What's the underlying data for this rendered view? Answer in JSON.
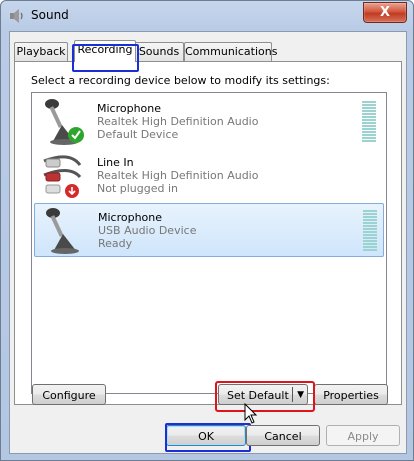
{
  "window": {
    "title": "Sound",
    "close_label": "X"
  },
  "tabs": [
    {
      "label": "Playback",
      "active": false
    },
    {
      "label": "Recording",
      "active": true
    },
    {
      "label": "Sounds",
      "active": false
    },
    {
      "label": "Communications",
      "active": false
    }
  ],
  "instruction": "Select a recording device below to modify its settings:",
  "devices": [
    {
      "name": "Microphone",
      "driver": "Realtek High Definition Audio",
      "status": "Default Device",
      "icon": "microphone-icon",
      "badge": "green-check-icon",
      "selected": false
    },
    {
      "name": "Line In",
      "driver": "Realtek High Definition Audio",
      "status": "Not plugged in",
      "icon": "line-in-jack-icon",
      "badge": "red-down-arrow-icon",
      "selected": false
    },
    {
      "name": "Microphone",
      "driver": "USB Audio Device",
      "status": "Ready",
      "icon": "microphone-icon",
      "badge": "",
      "selected": true
    }
  ],
  "buttons": {
    "configure": "Configure",
    "set_default": "Set Default",
    "properties": "Properties",
    "ok": "OK",
    "cancel": "Cancel",
    "apply": "Apply"
  },
  "colors": {
    "highlight_blue": "#1a2fd6",
    "highlight_red": "#e0121a",
    "selection": "#cfe5fb",
    "meter": "#9bd3d0"
  }
}
